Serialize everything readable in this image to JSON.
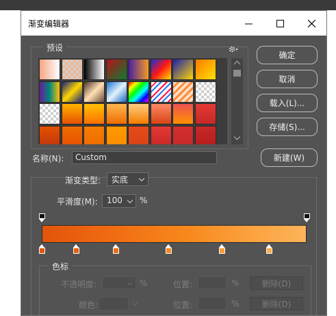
{
  "window": {
    "title": "渐变编辑器"
  },
  "presets": {
    "label": "预设",
    "swatches": [
      "linear-gradient(90deg,#f4a582,#ffffff)",
      "checker-orange",
      "linear-gradient(90deg,#000000,#ffffff)",
      "linear-gradient(135deg,#b5121b,#0d7a2f)",
      "linear-gradient(90deg,#4b1fa0,#f29a23)",
      "linear-gradient(135deg,#1a2fd6,#ff1616,#ffe100)",
      "linear-gradient(135deg,#1b1fb0,#ffd500)",
      "linear-gradient(135deg,#ff7a00,#ffe100)",
      "linear-gradient(90deg,#6a1b9a,#00897b,#ffc107)",
      "linear-gradient(135deg,#1a237e,#ffd600,#1a237e)",
      "linear-gradient(135deg,#4e342e,#ffe0b2,#6d4c41)",
      "linear-gradient(135deg,#1976d2,#e3f2fd,#1565c0)",
      "linear-gradient(135deg,#ff0000,#ffff00,#00ff00,#00ffff,#0000ff,#ff00ff)",
      "stripes-rainbow",
      "stripes-orange",
      "checker",
      "checker",
      "linear-gradient(180deg,#ffb300,#e65100)",
      "linear-gradient(180deg,#ffc107,#ff6f00)",
      "linear-gradient(180deg,#ffb74d,#ef6c00)",
      "linear-gradient(180deg,#ffcc80,#f57c00)",
      "linear-gradient(180deg,#ff8a65,#d84315)",
      "linear-gradient(180deg,#ef5350,#ff8f00)",
      "linear-gradient(180deg,#e53935,#c62828)",
      "linear-gradient(180deg,#e65100,#bf360c)",
      "linear-gradient(180deg,#ef6c00,#e65100)",
      "linear-gradient(180deg,#f57c00,#ef6c00)",
      "linear-gradient(180deg,#ff9800,#fb8c00)",
      "linear-gradient(180deg,#e64a19,#d84315)",
      "linear-gradient(180deg,#e53935,#c62828)",
      "linear-gradient(180deg,#d32f2f,#c62828)",
      "linear-gradient(180deg,#c62828,#b71c1c)"
    ]
  },
  "buttons": {
    "ok": "确定",
    "cancel": "取消",
    "load": "载入(L)...",
    "save": "存储(S)...",
    "new": "新建(W)"
  },
  "name": {
    "label": "名称(N):",
    "value": "Custom"
  },
  "gradient_type": {
    "label": "渐变类型:",
    "value": "实底"
  },
  "smoothness": {
    "label": "平滑度(M):",
    "value": "100",
    "unit": "%"
  },
  "gradient": {
    "fill": "linear-gradient(90deg,#e0550c 0%,#f06a12 25%,#f7891c 55%,#fba340 80%,#fdb45a 100%)",
    "opacity_stops": [
      0,
      1
    ],
    "color_stops": [
      {
        "position": 0.0,
        "color": "#e0550c"
      },
      {
        "position": 0.13,
        "color": "#e8600f"
      },
      {
        "position": 0.28,
        "color": "#ef6c14"
      },
      {
        "position": 0.48,
        "color": "#f7861c"
      },
      {
        "position": 0.68,
        "color": "#fb9b2e"
      },
      {
        "position": 0.86,
        "color": "#fcac4c"
      }
    ]
  },
  "stops_group": {
    "label": "色标",
    "opacity_label": "不透明度:",
    "opacity_unit": "%",
    "position_label": "位置:",
    "position_unit": "%",
    "delete_label": "删除(D)",
    "color_label": "颜色:",
    "position2_label": "位置:",
    "position2_unit": "%",
    "delete2_label": "删除(D)"
  }
}
